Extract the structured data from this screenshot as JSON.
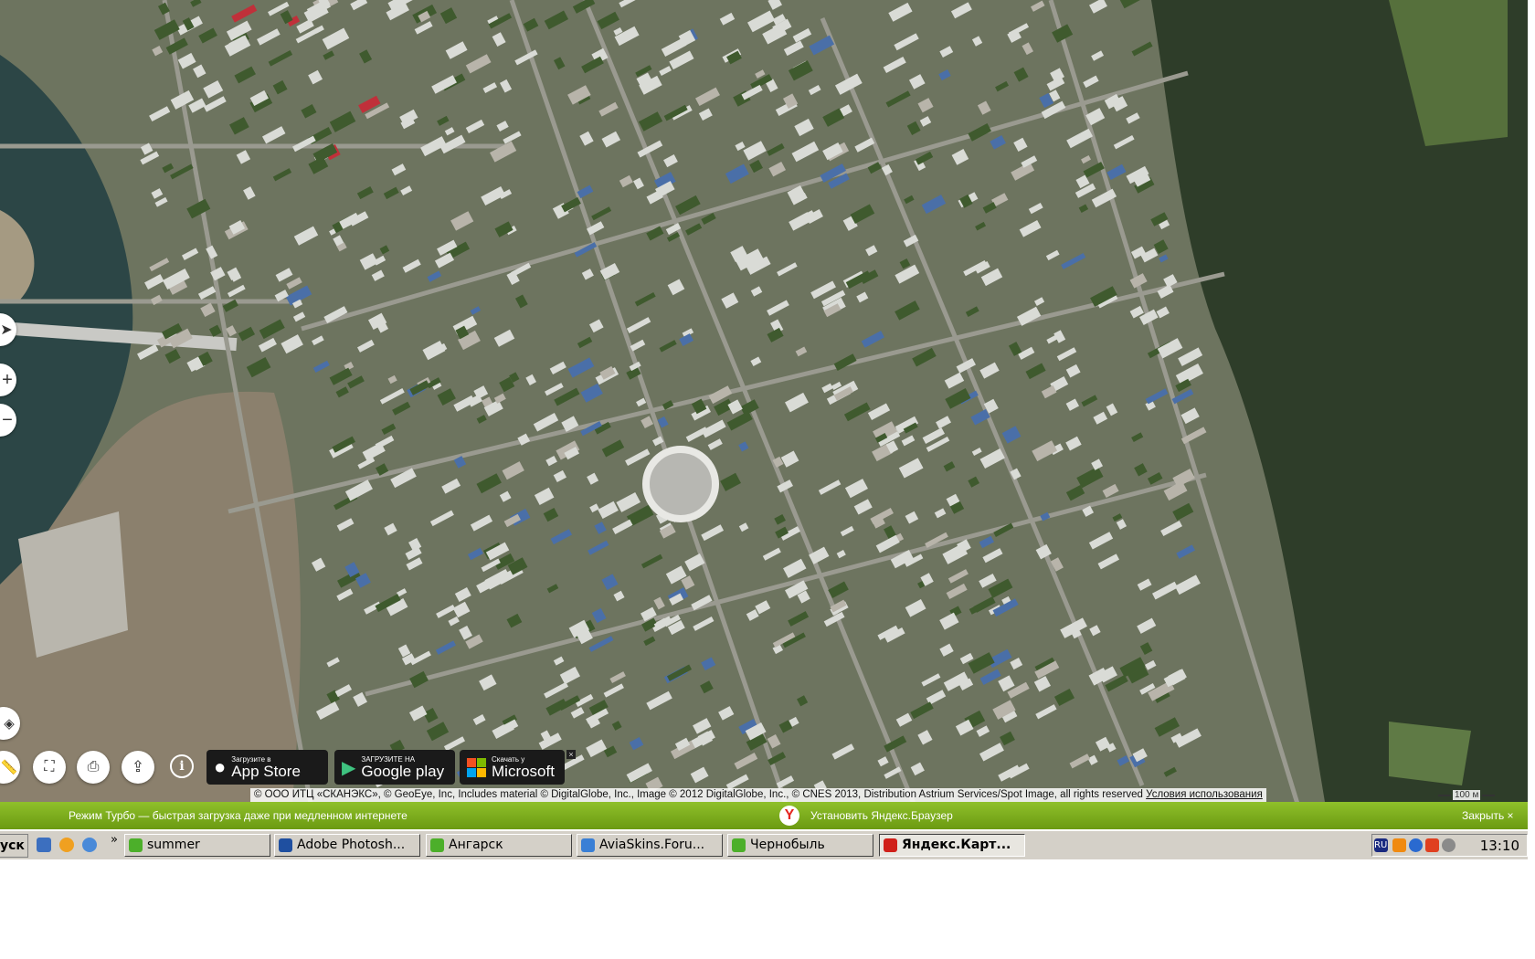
{
  "map": {
    "controls": {
      "route_icon": "navigation-arrow-icon",
      "zoom_in": "+",
      "zoom_out": "−",
      "layers_icon": "layers-icon",
      "ruler_icon": "ruler-icon",
      "panorama_icon": "binoculars-icon",
      "print_icon": "printer-icon",
      "share_icon": "share-icon",
      "info": "i"
    },
    "badges": [
      {
        "small": "Загрузите в",
        "big": "App Store",
        "icon": "apple-icon"
      },
      {
        "small": "ЗАГРУЗИТЕ НА",
        "big": "Google play",
        "icon": "google-play-icon"
      },
      {
        "small": "Скачать у",
        "big": "Microsoft",
        "icon": "microsoft-icon"
      }
    ],
    "badge_close": "×",
    "attribution": "© ООО ИТЦ «СКАНЭКС», © GeoEye, Inc, Includes material © DigitalGlobe, Inc., Image © 2012 DigitalGlobe, Inc., © CNES 2013, Distribution Astrium Services/Spot Image, all rights reserved",
    "terms_link": "Условия использования",
    "scale": "100 м"
  },
  "turbo_bar": {
    "message": "Режим Турбо — быстрая загрузка даже при медленном интернете",
    "logo": "Y",
    "install": "Установить Яндекс.Браузер",
    "close": "Закрыть ×"
  },
  "taskbar": {
    "start": "уск",
    "more": "»",
    "tasks": [
      {
        "label": "summer",
        "color": "#4caf2a"
      },
      {
        "label": "Adobe Photosh...",
        "color": "#1f4fa0"
      },
      {
        "label": "Ангарск",
        "color": "#4caf2a"
      },
      {
        "label": "AviaSkins.Foru...",
        "color": "#3a7fd5"
      },
      {
        "label": "Чернобыль",
        "color": "#4caf2a"
      },
      {
        "label": "Яндекс.Карт...",
        "color": "#d0201a"
      }
    ],
    "tray_lang": "RU",
    "clock": "13:10"
  }
}
